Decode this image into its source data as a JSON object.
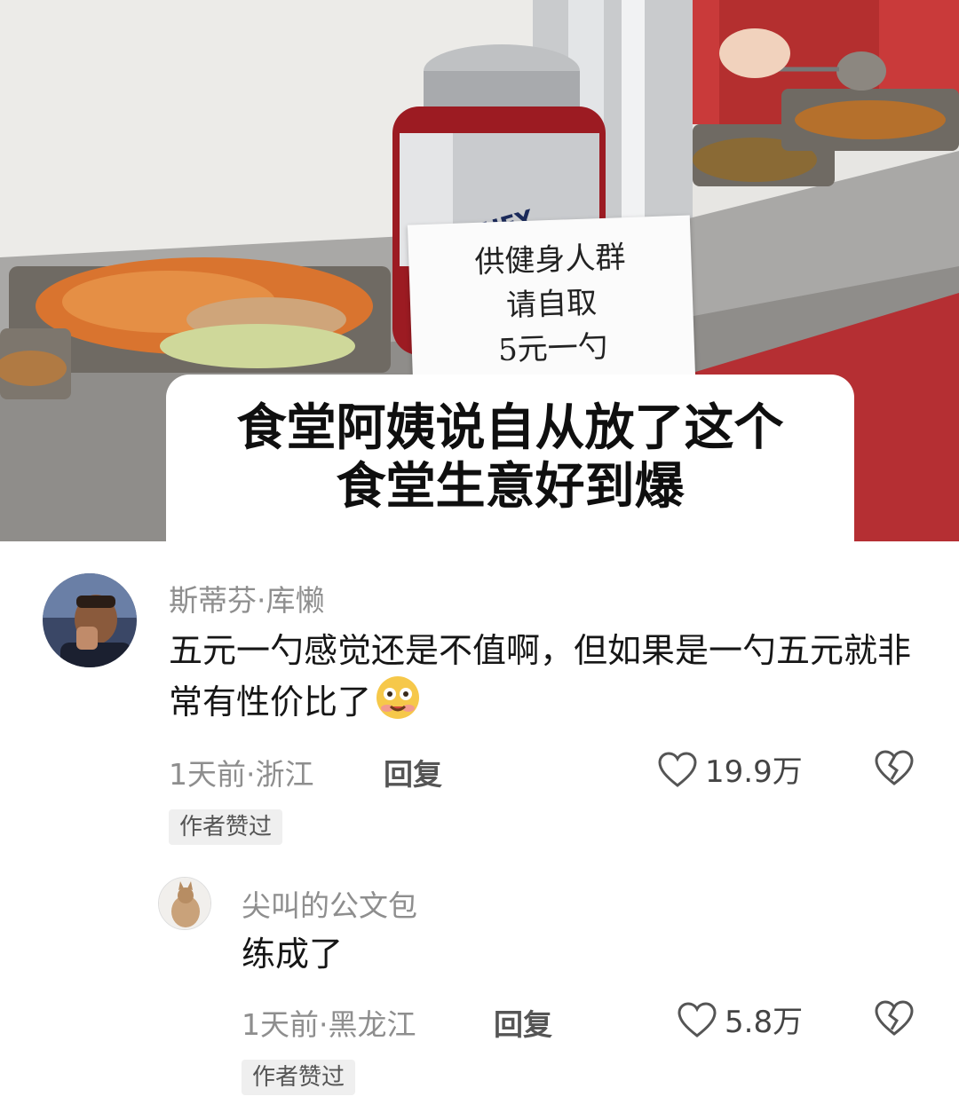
{
  "photo": {
    "sign_lines": [
      "供健身人群",
      "请自取",
      "5元一勺"
    ],
    "jar_brand": "E-WHEY",
    "caption_lines": [
      "食堂阿姨说自从放了这个",
      "食堂生意好到爆"
    ]
  },
  "comments": [
    {
      "username": "斯蒂芬·库懒",
      "text": "五元一勺感觉还是不值啊，但如果是一勺五元就非常有性价比了",
      "emoji": "drooling-face-emoji",
      "time_location": "1天前·浙江",
      "reply_label": "回复",
      "likes": "19.9万",
      "badge": "作者赞过"
    },
    {
      "username": "尖叫的公文包",
      "text": "练成了",
      "time_location": "1天前·黑龙江",
      "reply_label": "回复",
      "likes": "5.8万",
      "badge": "作者赞过"
    }
  ],
  "icons": {
    "like": "heart-outline-icon",
    "dislike": "broken-heart-icon"
  },
  "colors": {
    "meta_gray": "#8e8e8e",
    "badge_bg": "#efefef",
    "jar_red": "#a01c22"
  }
}
